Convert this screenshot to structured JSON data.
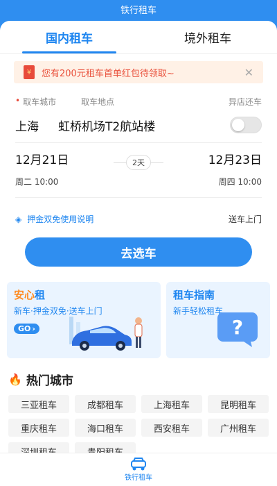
{
  "app": {
    "title": "铁行租车"
  },
  "tabs": [
    {
      "label": "国内租车",
      "active": true
    },
    {
      "label": "境外租车",
      "active": false
    }
  ],
  "notice": {
    "icon": "red-packet-icon",
    "text": "您有200元租车首单红包待领取~",
    "close": "✕"
  },
  "form": {
    "pickup_city_label": "取车城市",
    "pickup_place_label": "取车地点",
    "diff_return_label": "异店还车",
    "city_value": "上海",
    "place_value": "虹桥机场T2航站楼",
    "diff_return_on": false,
    "pickup_date": "12月21日",
    "pickup_weekday_time": "周二  10:00",
    "duration": "2天",
    "return_date": "12月23日",
    "return_weekday_time": "周四  10:00",
    "deposit_text": "押金双免使用说明",
    "delivery_text": "送车上门",
    "submit_label": "去选车"
  },
  "promos": {
    "left": {
      "title_part1": "安心",
      "title_part2": "租",
      "subtitle": "新车·押金双免·送车上门",
      "go": "GO"
    },
    "right": {
      "title": "租车指南",
      "subtitle": "新手轻松租车"
    }
  },
  "hot": {
    "title": "热门城市",
    "cities": [
      "三亚租车",
      "成都租车",
      "上海租车",
      "昆明租车",
      "重庆租车",
      "海口租车",
      "西安租车",
      "广州租车",
      "深圳租车",
      "贵阳租车"
    ]
  },
  "bottom_nav": {
    "label": "铁行租车",
    "icon": "car-icon"
  },
  "colors": {
    "brand": "#2f8ef0",
    "accent": "#ff8a1f",
    "alert": "#e9513c"
  }
}
